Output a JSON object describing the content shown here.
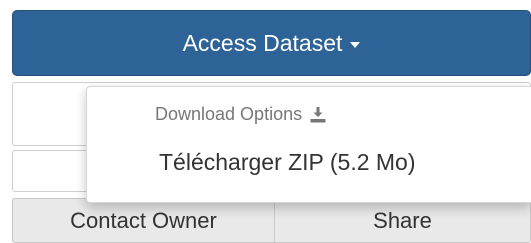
{
  "access_button": {
    "label": "Access Dataset",
    "icon": "caret-down-icon",
    "color": "#2d6397"
  },
  "dropdown": {
    "header": "Download Options",
    "header_icon": "download-icon",
    "items": [
      {
        "label": "Télécharger ZIP (5.2 Mo)"
      }
    ]
  },
  "bottom_buttons": {
    "contact_owner": "Contact Owner",
    "share": "Share"
  }
}
